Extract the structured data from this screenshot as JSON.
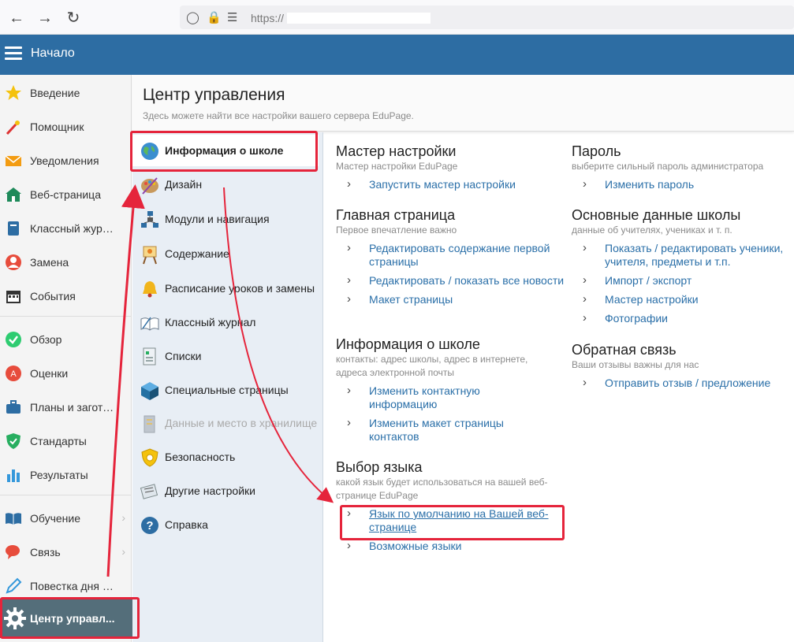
{
  "browser": {
    "url": "https://"
  },
  "appbar": {
    "title": "Начало"
  },
  "sidebar": {
    "items": [
      {
        "label": "Введение",
        "icon": "star-icon"
      },
      {
        "label": "Помощник",
        "icon": "magic-wand-icon"
      },
      {
        "label": "Уведомления",
        "icon": "envelope-icon"
      },
      {
        "label": "Веб-страница",
        "icon": "house-icon"
      },
      {
        "label": "Классный журнал",
        "icon": "notebook-icon"
      },
      {
        "label": "Замена",
        "icon": "person-icon"
      },
      {
        "label": "События",
        "icon": "calendar-icon"
      },
      {
        "label": "Обзор",
        "icon": "check-circle-icon"
      },
      {
        "label": "Оценки",
        "icon": "grades-icon"
      },
      {
        "label": "Планы и заготовки",
        "icon": "briefcase-icon"
      },
      {
        "label": "Стандарты",
        "icon": "shield-check-icon"
      },
      {
        "label": "Результаты",
        "icon": "bar-chart-icon"
      },
      {
        "label": "Обучение",
        "icon": "book-icon"
      },
      {
        "label": "Связь",
        "icon": "chat-icon"
      },
      {
        "label": "Повестка дня урока",
        "icon": "pen-icon"
      }
    ],
    "active": {
      "label": "Центр управл...",
      "icon": "gear-icon"
    }
  },
  "header": {
    "title": "Центр управления",
    "subtitle": "Здесь можете найти все настройки вашего сервера EduPage."
  },
  "sections": [
    {
      "label": "Информация о школе",
      "icon": "globe-icon"
    },
    {
      "label": "Дизайн",
      "icon": "palette-icon"
    },
    {
      "label": "Модули и навигация",
      "icon": "network-icon"
    },
    {
      "label": "Содержание",
      "icon": "easel-icon"
    },
    {
      "label": "Расписание уроков и замены",
      "icon": "bell-icon"
    },
    {
      "label": "Классный журнал",
      "icon": "open-book-icon"
    },
    {
      "label": "Списки",
      "icon": "list-icon"
    },
    {
      "label": "Специальные страницы",
      "icon": "cube-icon"
    },
    {
      "label": "Данные и место в хранилище",
      "icon": "server-icon"
    },
    {
      "label": "Безопасность",
      "icon": "security-shield-icon"
    },
    {
      "label": "Другие настройки",
      "icon": "tools-icon"
    },
    {
      "label": "Справка",
      "icon": "help-icon"
    }
  ],
  "groups": {
    "wizard": {
      "title": "Мастер настройки",
      "desc": "Мастер настройки EduPage",
      "links": [
        "Запустить мастер настройки"
      ]
    },
    "main_page": {
      "title": "Главная страница",
      "desc": "Первое впечатление важно",
      "links": [
        "Редактировать содержание первой страницы",
        "Редактировать / показать все новости",
        "Макет страницы"
      ]
    },
    "school_info": {
      "title": "Информация о школе",
      "desc": "контакты: адрес школы, адрес в интернете, адреса электронной почты",
      "links": [
        "Изменить контактную информацию",
        "Изменить макет страницы контактов"
      ]
    },
    "language": {
      "title": "Выбор языка",
      "desc": "какой язык будет использоваться на вашей веб-странице EduPage",
      "links": [
        "Язык по умолчанию на Вашей веб-странице",
        "Возможные языки"
      ]
    },
    "password": {
      "title": "Пароль",
      "desc": "выберите сильный пароль администратора",
      "links": [
        "Изменить пароль"
      ]
    },
    "basic_data": {
      "title": "Основные данные школы",
      "desc": "данные об учителях, учениках и т. п.",
      "links": [
        "Показать / редактировать ученики, учителя, предметы и т.п.",
        "Импорт / экспорт",
        "Мастер настройки",
        "Фотографии"
      ]
    },
    "feedback": {
      "title": "Обратная связь",
      "desc": "Ваши отзывы важны для нас",
      "links": [
        "Отправить отзыв / предложение"
      ]
    }
  },
  "colors": {
    "appbar": "#2d6da3",
    "link": "#2a6fa8",
    "highlight": "#e5243b",
    "active_sidebar": "#546e7a"
  }
}
